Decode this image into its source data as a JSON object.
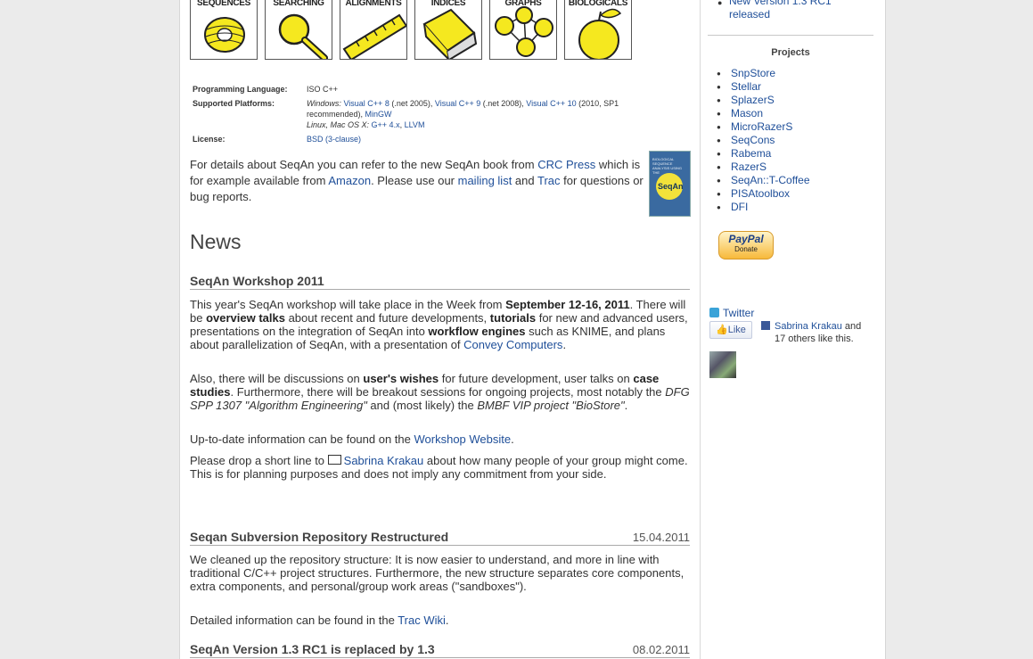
{
  "tiles": [
    "SEQUENCES",
    "SEARCHING",
    "ALIGNMENTS",
    "INDICES",
    "GRAPHS",
    "BIOLOGICALS"
  ],
  "info": {
    "lang_label": "Programming Language:",
    "lang_value": "ISO C++",
    "plat_label": "Supported Platforms:",
    "plat_windows": "Windows:",
    "plat_vc8": "Visual C++ 8",
    "plat_vc8_note": " (.net 2005), ",
    "plat_vc9": "Visual C++ 9",
    "plat_vc9_note": " (.net 2008), ",
    "plat_vc10": "Visual C++ 10",
    "plat_vc10_note": " (2010, SP1 recommended), ",
    "plat_mingw": "MinGW",
    "plat_unix": "Linux, Mac OS X:",
    "plat_gcc": "G++ 4.x",
    "plat_sep": ", ",
    "plat_llvm": "LLVM",
    "lic_label": "License:",
    "lic_value": "BSD (3-clause)"
  },
  "intro": {
    "t1": "For details about SeqAn you can refer to the new SeqAn book from ",
    "crc": "CRC Press",
    "t2": " which is for example available from ",
    "amazon": "Amazon",
    "t3": ". Please use our ",
    "mailing": "mailing list",
    "t4": " and ",
    "trac": "Trac",
    "t5": " for questions or bug reports."
  },
  "book": {
    "title": "BIOLOGICAL SEQUENCE ANALYSIS USING THE",
    "logo": "SeqAn"
  },
  "news": {
    "heading": "News",
    "n1": {
      "title": "SeqAn Workshop 2011",
      "p1a": "This year's SeqAn workshop will take place in the Week from ",
      "p1b": "September 12-16, 2011",
      "p1c": ". There will be ",
      "p1d": "overview talks",
      "p1e": " about recent and future developments, ",
      "p1f": "tutorials",
      "p1g": " for new and advanced users, presentations on the integration of SeqAn into ",
      "p1h": "workflow engines",
      "p1i": " such as KNIME, and plans about parallelization of SeqAn, with a presentation of ",
      "p1j": "Convey Computers",
      "p1k": ".",
      "p2a": "Also, there will be discussions on ",
      "p2b": "user's wishes",
      "p2c": " for future development, user talks on ",
      "p2d": "case studies",
      "p2e": ". Furthermore, there will be breakout sessions for ongoing projects, most notably the ",
      "p2f": "DFG SPP 1307 \"Algorithm Engineering\"",
      "p2g": " and (most likely) the ",
      "p2h": "BMBF VIP project \"BioStore\"",
      "p2i": ".",
      "p3a": "Up-to-date information can be found on the ",
      "p3b": "Workshop Website",
      "p3c": ".",
      "p4a": "Please drop a short line to ",
      "p4b": "Sabrina Krakau",
      "p4c": " about how many people of your group might come. This is for planning purposes and does not imply any commitment from your side."
    },
    "n2": {
      "title": "Seqan Subversion Repository Restructured",
      "date": "15.04.2011",
      "p1": "We cleaned up the repository structure: It is now easier to understand, and more in line with traditional C/C++ project structures. Furthermore, the new structure separates core components, extra components, and personal/group work areas (\"sandboxes\").",
      "p2a": "Detailed information can be found in the ",
      "p2b": "Trac Wiki",
      "p2c": "."
    },
    "n3": {
      "title": "SeqAn Version 1.3 RC1 is replaced by 1.3",
      "date": "08.02.2011"
    }
  },
  "sidebar": {
    "top_link": "New Version 1.3 RC1 released",
    "projects_heading": "Projects",
    "projects": [
      "SnpStore",
      "Stellar",
      "SplazerS",
      "Mason",
      "MicroRazerS",
      "SeqCons",
      "Rabema",
      "RazerS",
      "SeqAn::T-Coffee",
      "PISAtoolbox",
      "DFI"
    ],
    "paypal": "PayPal",
    "donate": "Donate",
    "twitter": "Twitter",
    "like": "Like",
    "fb_name": "Sabrina Krakau",
    "fb_and": " and",
    "fb_others": "17 others like this."
  }
}
